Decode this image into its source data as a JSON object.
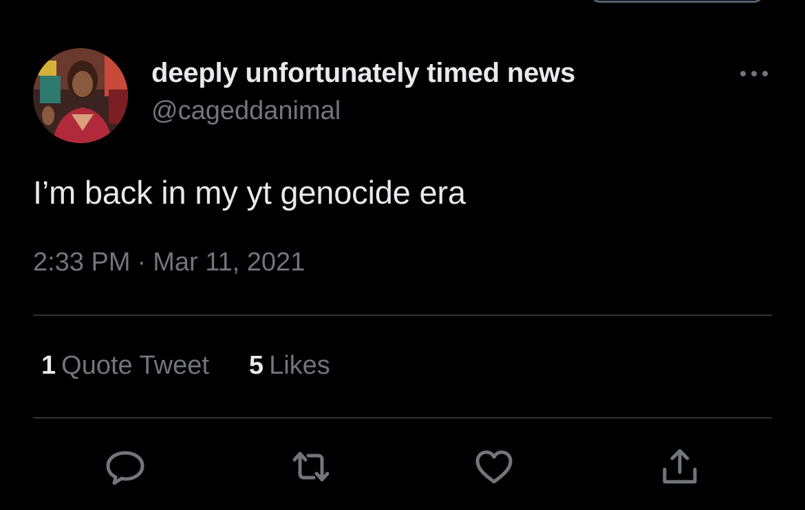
{
  "colors": {
    "background": "#000000",
    "primary_text": "#e7e9ea",
    "secondary_text": "#71767b",
    "divider": "#2f3336"
  },
  "author": {
    "display_name": "deeply unfortunately timed news",
    "handle": "@cageddanimal",
    "avatar_icon": "profile-photo"
  },
  "tweet": {
    "text": "I’m back in my yt genocide era",
    "time": "2:33 PM",
    "separator": "·",
    "date": "Mar 11, 2021"
  },
  "stats": {
    "quote_tweets": {
      "count": "1",
      "label": "Quote Tweet"
    },
    "likes": {
      "count": "5",
      "label": "Likes"
    }
  },
  "actions": [
    {
      "icon": "reply-icon"
    },
    {
      "icon": "retweet-icon"
    },
    {
      "icon": "like-icon"
    },
    {
      "icon": "share-icon"
    }
  ],
  "menu_icon": "more-options-icon"
}
